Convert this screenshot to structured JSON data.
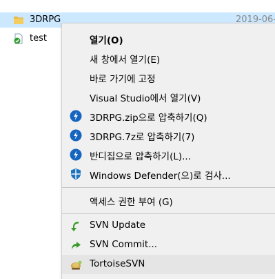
{
  "explorer": {
    "files": [
      {
        "name": "3DRPG",
        "date": "2019-06-",
        "icon": "folder-icon",
        "selected": true
      },
      {
        "name": "test",
        "date": "",
        "icon": "file-svn-check-icon",
        "selected": false
      }
    ]
  },
  "context_menu": {
    "items": [
      {
        "label": "열기(O)",
        "icon": ""
      },
      {
        "label": "새 창에서 열기(E)",
        "icon": ""
      },
      {
        "label": "바로 가기에 고정",
        "icon": ""
      },
      {
        "label": "Visual Studio에서 열기(V)",
        "icon": ""
      },
      {
        "label": "3DRPG.zip으로 압축하기(Q)",
        "icon": "bandizip-icon"
      },
      {
        "label": "3DRPG.7z로 압축하기(7)",
        "icon": "bandizip-icon"
      },
      {
        "label": "반디집으로 압축하기(L)...",
        "icon": "bandizip-icon"
      },
      {
        "label": "Windows Defender(으)로 검사...",
        "icon": "windows-defender-icon"
      },
      {
        "label": "액세스 권한 부여 (G)",
        "icon": ""
      },
      {
        "label": "SVN Update",
        "icon": "svn-update-icon"
      },
      {
        "label": "SVN Commit...",
        "icon": "svn-commit-icon"
      },
      {
        "label": "TortoiseSVN",
        "icon": "tortoisesvn-icon"
      }
    ]
  },
  "colors": {
    "selection": "#cce8ff",
    "menu_bg": "#f0f0f0",
    "menu_hover": "#e5e5e5",
    "bandizip_blue": "#1565c0",
    "svn_green": "#3a9a2a"
  }
}
